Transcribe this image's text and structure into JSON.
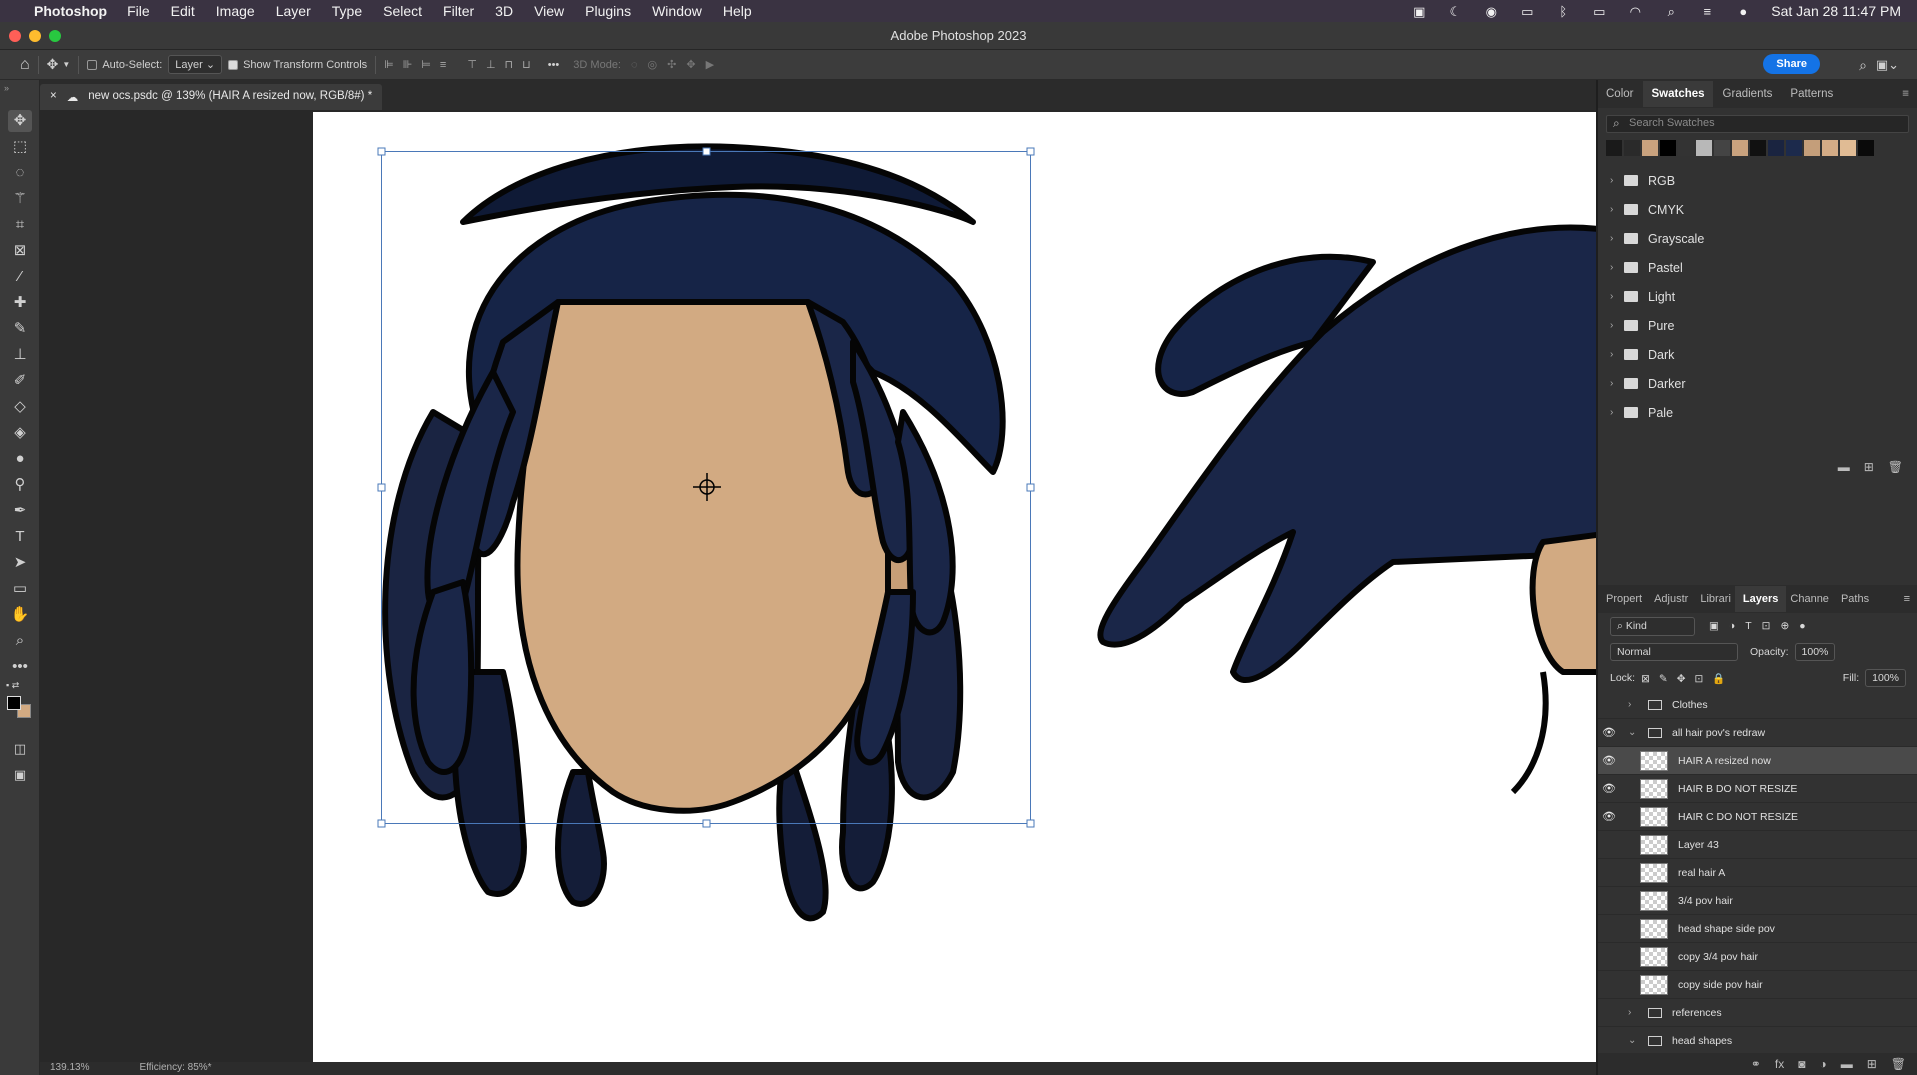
{
  "menubar": {
    "app": "Photoshop",
    "menus": [
      "File",
      "Edit",
      "Image",
      "Layer",
      "Type",
      "Select",
      "Filter",
      "3D",
      "View",
      "Plugins",
      "Window",
      "Help"
    ],
    "clock": "Sat Jan 28  11:47 PM"
  },
  "window": {
    "title": "Adobe Photoshop 2023"
  },
  "options": {
    "auto_select_label": "Auto-Select:",
    "auto_select_value": "Layer",
    "transform_controls_label": "Show Transform Controls",
    "mode_3d_label": "3D Mode:",
    "share_label": "Share"
  },
  "document": {
    "tab_title": "new ocs.psdc @ 139% (HAIR A resized now, RGB/8#) *"
  },
  "status": {
    "zoom": "139.13%",
    "efficiency": "Efficiency: 85%*"
  },
  "swatches_panel": {
    "tabs": [
      "Color",
      "Swatches",
      "Gradients",
      "Patterns"
    ],
    "active_tab": "Swatches",
    "search_placeholder": "Search Swatches",
    "swatch_colors": [
      "#1a1a1a",
      "#2a2a2a",
      "#c9a27e",
      "#000000",
      "#333333",
      "#b8b8b8",
      "#444444",
      "#c9a27e",
      "#111111",
      "#1a2440",
      "#1c2a4c",
      "#c49e7a",
      "#d4ac86",
      "#e0bb94",
      "#0a0a0a"
    ],
    "folders": [
      "RGB",
      "CMYK",
      "Grayscale",
      "Pastel",
      "Light",
      "Pure",
      "Dark",
      "Darker",
      "Pale"
    ]
  },
  "layers_panel": {
    "tabs": [
      "Propert",
      "Adjustr",
      "Librari",
      "Layers",
      "Channe",
      "Paths"
    ],
    "active_tab": "Layers",
    "filter_value": "Kind",
    "blend_mode": "Normal",
    "opacity_label": "Opacity:",
    "opacity_value": "100%",
    "lock_label": "Lock:",
    "fill_label": "Fill:",
    "fill_value": "100%",
    "layers": [
      {
        "name": "Clothes",
        "type": "group",
        "visible": false,
        "expanded": false,
        "indent": 0
      },
      {
        "name": "all hair pov's redraw",
        "type": "group",
        "visible": true,
        "expanded": true,
        "indent": 0
      },
      {
        "name": "HAIR A resized now",
        "type": "layer",
        "visible": true,
        "selected": true,
        "indent": 1
      },
      {
        "name": "HAIR B DO NOT RESIZE",
        "type": "layer",
        "visible": true,
        "indent": 1
      },
      {
        "name": "HAIR C DO NOT RESIZE",
        "type": "layer",
        "visible": true,
        "indent": 1
      },
      {
        "name": "Layer 43",
        "type": "layer",
        "visible": false,
        "indent": 1
      },
      {
        "name": "real hair A",
        "type": "layer",
        "visible": false,
        "indent": 1
      },
      {
        "name": "3/4 pov hair",
        "type": "layer",
        "visible": false,
        "indent": 1
      },
      {
        "name": "head shape side pov",
        "type": "layer",
        "visible": false,
        "indent": 1
      },
      {
        "name": "copy 3/4 pov hair",
        "type": "layer",
        "visible": false,
        "indent": 1
      },
      {
        "name": "copy side pov hair",
        "type": "layer",
        "visible": false,
        "indent": 1
      },
      {
        "name": "references",
        "type": "group",
        "visible": false,
        "expanded": false,
        "indent": 0
      },
      {
        "name": "head shapes",
        "type": "group",
        "visible": false,
        "expanded": true,
        "indent": 0
      }
    ]
  },
  "colors": {
    "hair": "#162447",
    "skin": "#d2aa82",
    "outline": "#050505",
    "accent": "#1473e6"
  }
}
